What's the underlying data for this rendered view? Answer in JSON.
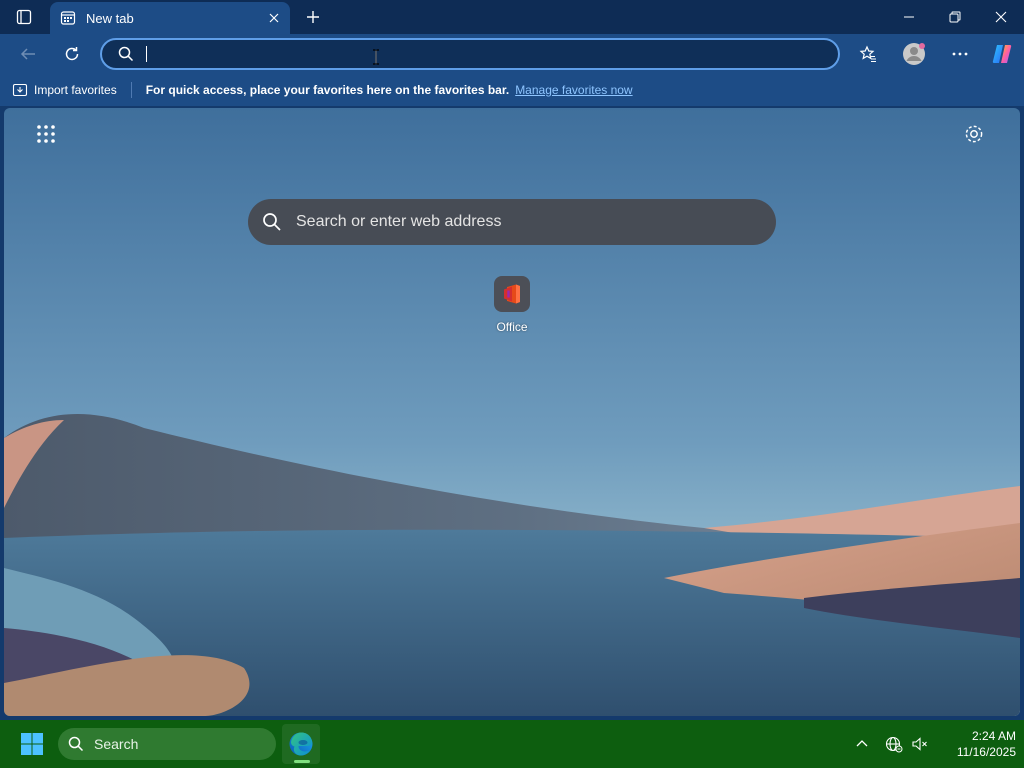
{
  "tab": {
    "title": "New tab"
  },
  "address_bar": {
    "value": "",
    "placeholder": ""
  },
  "favorites_bar": {
    "import_label": "Import favorites",
    "message": "For quick access, place your favorites here on the favorites bar.",
    "manage_link": "Manage favorites now"
  },
  "ntp": {
    "search_placeholder": "Search or enter web address",
    "tiles": [
      {
        "label": "Office"
      }
    ]
  },
  "taskbar": {
    "search_label": "Search",
    "time": "2:24 AM",
    "date": "11/16/2025"
  },
  "colors": {
    "accent": "#5f9ee8",
    "tab_active": "#1d4c86",
    "taskbar": "#0d5e0f"
  }
}
